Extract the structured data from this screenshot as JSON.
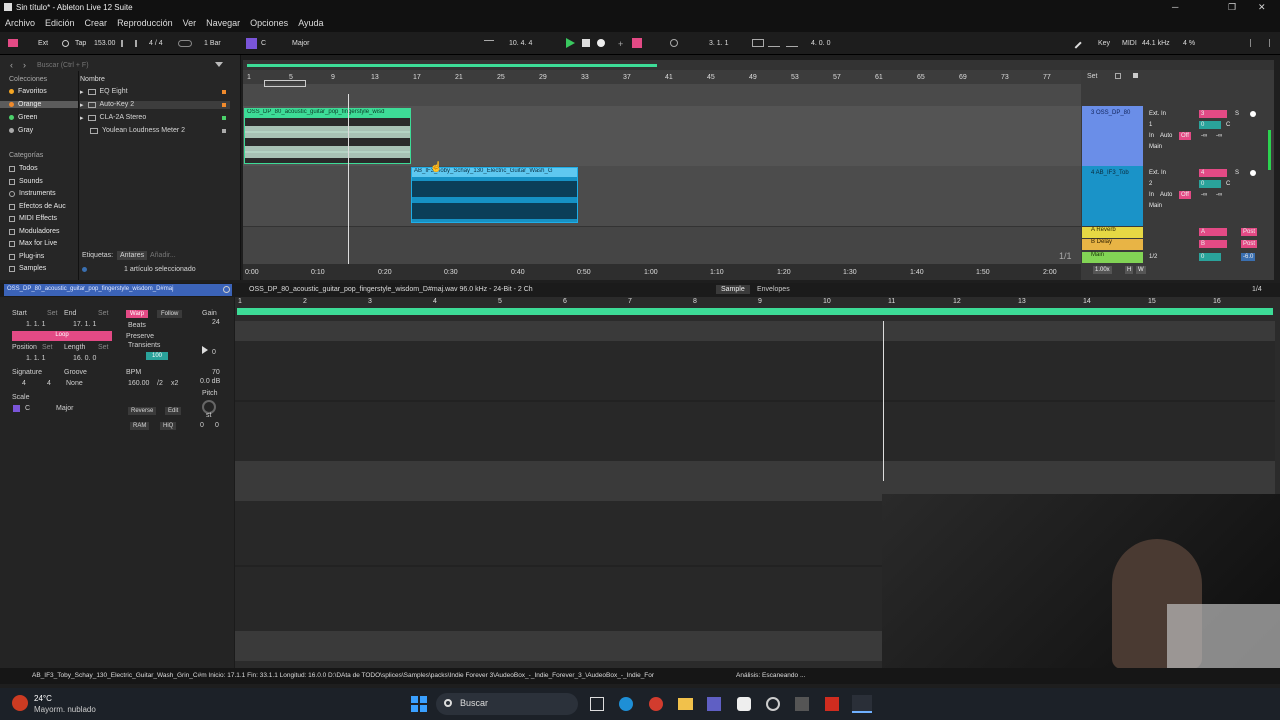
{
  "window": {
    "title": "Sin título* - Ableton Live 12 Suite",
    "minimize": "─",
    "maximize": "❐",
    "close": "✕"
  },
  "menu": [
    "Archivo",
    "Edición",
    "Crear",
    "Reproducción",
    "Ver",
    "Navegar",
    "Opciones",
    "Ayuda"
  ],
  "transport": {
    "ext": "Ext",
    "tap": "Tap",
    "tempo": "153.00",
    "meter": "4 / 4",
    "quantize": "1 Bar",
    "key_root": "C",
    "scale": "Major",
    "position": "10.  4.  4",
    "loop_start": "3.  1.  1",
    "loop_length": "4.  0.  0",
    "key_label": "Key",
    "midi_label": "MIDI",
    "sample_rate": "44.1 kHz",
    "cpu": "4 %"
  },
  "browser": {
    "search_placeholder": "Buscar (Ctrl + F)",
    "collections_header": "Colecciones",
    "collections": [
      {
        "name": "Favoritos",
        "color": "#f5a623"
      },
      {
        "name": "Orange",
        "color": "#f08a2c"
      },
      {
        "name": "Green",
        "color": "#4bd16b"
      },
      {
        "name": "Gray",
        "color": "#aaaaaa"
      }
    ],
    "categories_header": "Categorías",
    "categories": [
      "Todos",
      "Sounds",
      "Instruments",
      "Efectos de Auc",
      "MIDI Effects",
      "Moduladores",
      "Max for Live",
      "Plug-ins",
      "Samples"
    ],
    "column_header": "Nombre",
    "items": [
      "EQ Eight",
      "Auto-Key 2",
      "CLA-2A Stereo",
      "Youlean Loudness Meter 2"
    ],
    "tags_label": "Etiquetas:",
    "tags_value": "Antares",
    "tags_add": "Añadir...",
    "selection_status": "1 artículo seleccionado"
  },
  "arrangement": {
    "bar_ruler": [
      "1",
      "5",
      "9",
      "13",
      "17",
      "21",
      "25",
      "29",
      "33",
      "37",
      "41",
      "45",
      "49",
      "53",
      "57",
      "61",
      "65",
      "69",
      "73",
      "77"
    ],
    "time_ruler": [
      "0:00",
      "0:10",
      "0:20",
      "0:30",
      "0:40",
      "0:50",
      "1:00",
      "1:10",
      "1:20",
      "1:30",
      "1:40",
      "1:50",
      "2:00"
    ],
    "clips": [
      {
        "name": "OSS_DP_80_acoustic_guitar_pop_fingerstyle_wisd",
        "color": "#3ddc97"
      },
      {
        "name": "AB_IF3_Toby_Schay_130_Electric_Guitar_Wash_G",
        "color": "#1eaee8"
      }
    ],
    "page": "1/1"
  },
  "mixer": {
    "set_label": "Set",
    "tracks": [
      {
        "name": "3 OSS_DP_80",
        "color": "#6a8ee8",
        "input": "Ext. In",
        "channel": "1",
        "monitor": "Auto",
        "off": "Off",
        "output": "Main",
        "number": "3",
        "vol": "0",
        "pan": "C",
        "solo": "S"
      },
      {
        "name": "4 AB_IF3_Tob",
        "color": "#1a93c8",
        "input": "Ext. In",
        "channel": "2",
        "monitor": "Auto",
        "off": "Off",
        "output": "Main",
        "number": "4",
        "vol": "0",
        "pan": "C",
        "solo": "S"
      }
    ],
    "in_label": "In",
    "inf": "-∞",
    "returns": [
      {
        "name": "A Reverb",
        "color": "#e6d844",
        "letter": "A",
        "post": "Post"
      },
      {
        "name": "B Delay",
        "color": "#e8b445",
        "letter": "B",
        "post": "Post"
      }
    ],
    "main": {
      "name": "Main",
      "color": "#82d455",
      "out": "1/2",
      "vol": "0",
      "db": "-6.0"
    },
    "zoom": "1.00x",
    "h": "H",
    "w": "W"
  },
  "clip_detail": {
    "clip_name": "OSS_DP_80_acoustic_guitar_pop_fingerstyle_wisdom_D#maj",
    "file_info": "OSS_DP_80_acoustic_guitar_pop_fingerstyle_wisdom_D#maj.wav  96.0 kHz - 24-Bit - 2 Ch",
    "tab_sample": "Sample",
    "tab_envelopes": "Envelopes",
    "page": "1/4",
    "start_label": "Start",
    "set": "Set",
    "end_label": "End",
    "start_val": "1.   1.   1",
    "end_val": "17.   1.   1",
    "loop_label": "Loop",
    "position_label": "Position",
    "length_label": "Length",
    "position_val": "1.   1.   1",
    "length_val": "16.   0.   0",
    "signature_label": "Signature",
    "groove_label": "Groove",
    "sig_num": "4",
    "sig_den": "4",
    "groove_val": "None",
    "scale_label": "Scale",
    "scale_root": "C",
    "scale_name": "Major",
    "warp": "Warp",
    "follow": "Follow",
    "warp_mode": "Beats",
    "preserve_label": "Preserve",
    "preserve_val": "Transients",
    "env_val": "100",
    "bpm_label": "BPM",
    "bpm": "160.00",
    "half": "/2",
    "double": "x2",
    "reverse": "Reverse",
    "edit": "Edit",
    "ram": "RAM",
    "hiq": "HiQ",
    "gain_label": "Gain",
    "gain_top": "24",
    "gain_zero": "0",
    "gain_low": "70",
    "gain_db": "0.0 dB",
    "pitch_label": "Pitch",
    "pitch_unit": "st",
    "pitch_semi": "0",
    "pitch_cent": "0",
    "bar_ruler": [
      "1",
      "2",
      "3",
      "4",
      "5",
      "6",
      "7",
      "8",
      "9",
      "10",
      "11",
      "12",
      "13",
      "14",
      "15",
      "16"
    ]
  },
  "status": {
    "text": "AB_IF3_Toby_Schay_130_Electric_Guitar_Wash_Grin_C#m  Inicio: 17.1.1  Fin: 33.1.1  Longitud: 16.0.0  D:\\DAta de TODO\\splices\\Samples\\packs\\Indie Forever 3\\AudeoBox_-_Indie_Forever_3_\\AudeoBox_-_Indie_For",
    "analysis": "Análisis: Escaneando ..."
  },
  "taskbar": {
    "temp": "24°C",
    "weather": "Mayorm. nublado",
    "search": "Buscar"
  }
}
